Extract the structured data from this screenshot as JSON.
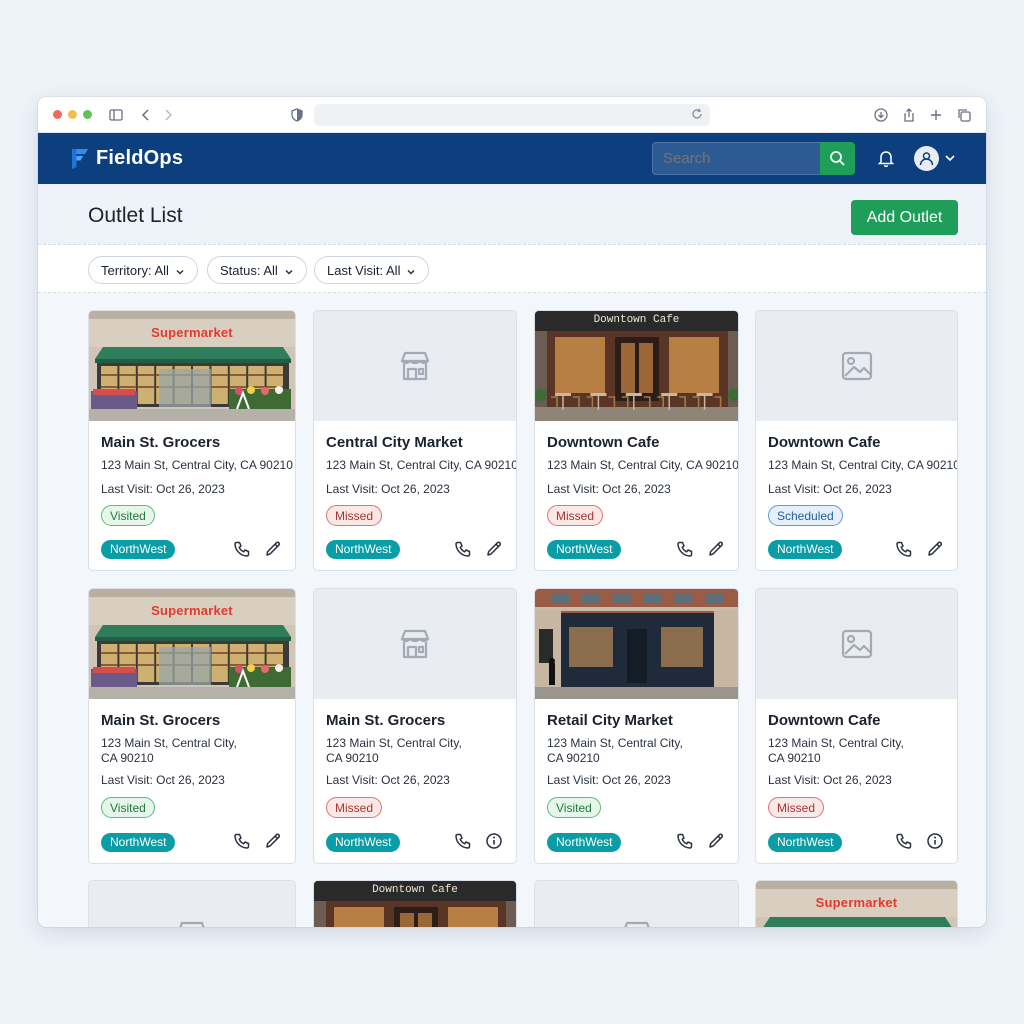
{
  "app": {
    "name": "FieldOps",
    "search_placeholder": "Search"
  },
  "page": {
    "title": "Outlet List",
    "add_label": "Add Outlet"
  },
  "filters": [
    {
      "label": "Territory: All"
    },
    {
      "label": "Status: All"
    },
    {
      "label": "Last Visit: All"
    }
  ],
  "cards": [
    {
      "name": "Main St. Grocers",
      "address_line1": "123 Main St, Central City, CA 90210",
      "address_line2": "",
      "last_visit": "Last Visit: Oct 26, 2023",
      "status": "Visited",
      "territory": "NorthWest",
      "image": "supermarket",
      "secondary_action": "edit-icon"
    },
    {
      "name": "Central City Market",
      "address_line1": "123 Main St, Central City, CA 90210",
      "address_line2": "",
      "last_visit": "Last Visit: Oct 26, 2023",
      "status": "Missed",
      "territory": "NorthWest",
      "image": "store-placeholder",
      "secondary_action": "edit-icon"
    },
    {
      "name": "Downtown Cafe",
      "address_line1": "123 Main St, Central City, CA 90210",
      "address_line2": "",
      "last_visit": "Last Visit: Oct 26, 2023",
      "status": "Missed",
      "territory": "NorthWest",
      "image": "cafe",
      "image_sign": "Downtown Cafe",
      "secondary_action": "edit-icon"
    },
    {
      "name": "Downtown Cafe",
      "address_line1": "123 Main St, Central City, CA 90210",
      "address_line2": "",
      "last_visit": "Last Visit: Oct 26, 2023",
      "status": "Scheduled",
      "territory": "NorthWest",
      "image": "image-placeholder",
      "secondary_action": "edit-icon"
    },
    {
      "name": "Main St. Grocers",
      "address_line1": "123 Main St, Central City,",
      "address_line2": "CA 90210",
      "last_visit": "Last Visit: Oct 26, 2023",
      "status": "Visited",
      "territory": "NorthWest",
      "image": "supermarket",
      "secondary_action": "edit-icon"
    },
    {
      "name": "Main St. Grocers",
      "address_line1": "123 Main St, Central City,",
      "address_line2": "CA 90210",
      "last_visit": "Last Visit: Oct 26, 2023",
      "status": "Missed",
      "territory": "NorthWest",
      "image": "store-placeholder",
      "secondary_action": "info-icon"
    },
    {
      "name": "Retail City Market",
      "address_line1": "123 Main St, Central City,",
      "address_line2": "CA 90210",
      "last_visit": "Last Visit: Oct 26, 2023",
      "status": "Visited",
      "territory": "NorthWest",
      "image": "storefront",
      "secondary_action": "edit-icon"
    },
    {
      "name": "Downtown Cafe",
      "address_line1": "123 Main St, Central City,",
      "address_line2": "CA 90210",
      "last_visit": "Last Visit: Oct 26, 2023",
      "status": "Missed",
      "territory": "NorthWest",
      "image": "image-placeholder",
      "secondary_action": "info-icon"
    },
    {
      "image": "store-placeholder"
    },
    {
      "image": "cafe",
      "image_sign": "Downtown Cafe"
    },
    {
      "image": "store-placeholder"
    },
    {
      "image": "supermarket"
    }
  ],
  "image_labels": {
    "supermarket": "Supermarket"
  },
  "colors": {
    "header": "#0d3f7e",
    "accent": "#1e9e58",
    "territory": "#0b9da6",
    "visited": "#5dbb76",
    "missed": "#d57870",
    "scheduled": "#5f9bd6"
  }
}
